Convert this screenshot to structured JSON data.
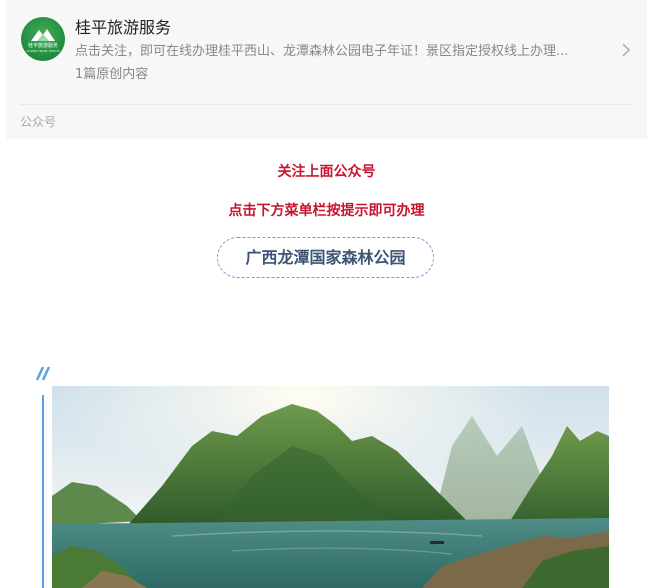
{
  "account": {
    "name": "桂平旅游服务",
    "description": "点击关注，即可在线办理桂平西山、龙潭森林公园电子年证！景区指定授权线上办理...",
    "original_count": "1篇原创内容",
    "footer_label": "公众号",
    "avatar_text": "桂平旅游服务",
    "avatar_subtext": "GUIPING TRAVEL SERVICE"
  },
  "content": {
    "line1": "关注上面公众号",
    "line2": "点击下方菜单栏按提示即可办理",
    "park_name": "广西龙潭国家森林公园"
  },
  "colors": {
    "accent_red": "#c8142f",
    "accent_blue": "#5b9ee3",
    "tag_text": "#3d5574",
    "avatar_green": "#22893e"
  },
  "icons": {
    "chevron": "chevron-right-icon",
    "decoration": "double-slash-icon"
  },
  "image": {
    "subject": "landscape-photo"
  }
}
